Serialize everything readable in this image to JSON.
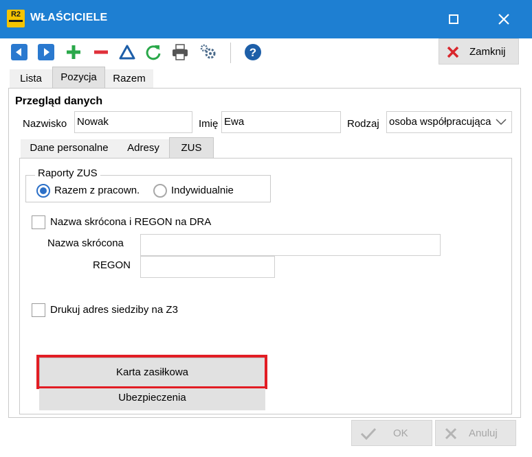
{
  "window": {
    "logo": "R2",
    "title": "WŁAŚCICIELE"
  },
  "toolbar": {
    "icons": [
      "arrow-left-icon",
      "arrow-right-icon",
      "plus-icon",
      "minus-icon",
      "triangle-up-icon",
      "refresh-icon",
      "printer-icon",
      "gears-icon",
      "help-icon"
    ],
    "close_label": "Zamknij"
  },
  "tabs": [
    "Lista",
    "Pozycja",
    "Razem"
  ],
  "section_title": "Przegląd danych",
  "form": {
    "nazwisko_label": "Nazwisko",
    "nazwisko_value": "Nowak",
    "imie_label": "Imię",
    "imie_value": "Ewa",
    "rodzaj_label": "Rodzaj",
    "rodzaj_value": "osoba współpracująca"
  },
  "inner_tabs": [
    "Dane personalne",
    "Adresy",
    "ZUS"
  ],
  "zus": {
    "raporty_legend": "Raporty ZUS",
    "radio_razem": "Razem z pracown.",
    "radio_indyw": "Indywidualnie",
    "cb_regon_label": "Nazwa skrócona i REGON na DRA",
    "nazwa_skr_label": "Nazwa skrócona",
    "nazwa_skr_value": "",
    "regon_label": "REGON",
    "regon_value": "",
    "cb_z3_label": "Drukuj adres siedziby na Z3",
    "karta_button": "Karta zasiłkowa",
    "ubezp_button": "Ubezpieczenia"
  },
  "footer": {
    "ok_label": "OK",
    "anuluj_label": "Anuluj"
  },
  "colors": {
    "titlebar": "#1e7fd2",
    "highlight": "#e21d24",
    "radio_selected": "#2b6fc7"
  }
}
